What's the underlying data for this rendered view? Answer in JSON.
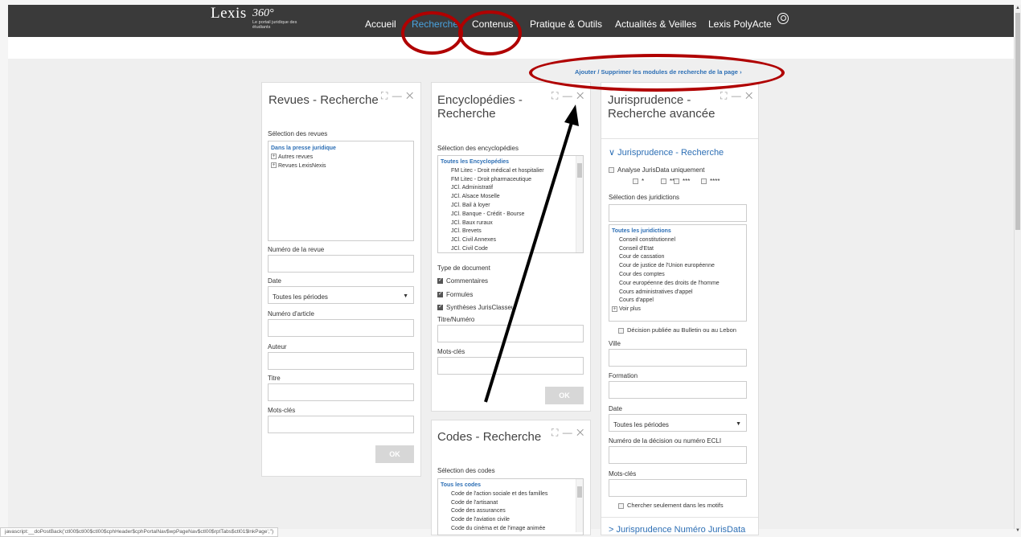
{
  "header": {
    "logo_word": "Lexis",
    "logo_num": "360°",
    "logo_tagline": "Le portail juridique des étudiants",
    "nav": [
      "Accueil",
      "Recherche",
      "Contenus",
      "Pratique & Outils",
      "Actualités & Veilles",
      "Lexis PolyActe"
    ]
  },
  "add_modules_link": "Ajouter / Supprimer les modules de recherche de la page ›",
  "revues": {
    "title": "Revues - Recherche",
    "selection_label": "Sélection des revues",
    "list_head": "Dans la presse juridique",
    "list_items": [
      "Autres revues",
      "Revues LexisNexis"
    ],
    "numero_revue": "Numéro de la revue",
    "date_label": "Date",
    "date_value": "Toutes les périodes",
    "numero_article": "Numéro d'article",
    "auteur": "Auteur",
    "titre": "Titre",
    "mots_cles": "Mots-clés",
    "ok": "OK"
  },
  "encyclopedies": {
    "title_line1": "Encyclopédies -",
    "title_line2": "Recherche",
    "selection_label": "Sélection des encyclopédies",
    "list_head": "Toutes les Encyclopédies",
    "list_items": [
      "FM Litec - Droit médical et hospitalier",
      "FM Litec - Droit pharmaceutique",
      "JCl. Administratif",
      "JCl. Alsace Moselle",
      "JCl. Bail à loyer",
      "JCl. Banque - Crédit - Bourse",
      "JCl. Baux ruraux",
      "JCl. Brevets",
      "JCl. Civil Annexes",
      "JCl. Civil Code"
    ],
    "type_label": "Type de document",
    "types": [
      "Commentaires",
      "Formules",
      "Synthèses JurisClasseur"
    ],
    "titre_numero": "Titre/Numéro",
    "mots_cles": "Mots-clés",
    "ok": "OK"
  },
  "codes": {
    "title": "Codes - Recherche",
    "selection_label": "Sélection des codes",
    "list_head": "Tous les codes",
    "list_items": [
      "Code de l'action sociale et des familles",
      "Code de l'artisanat",
      "Code des assurances",
      "Code de l'aviation civile",
      "Code du cinéma et de l'image animée"
    ]
  },
  "jurisprudence": {
    "title_line1": "Jurisprudence -",
    "title_line2": "Recherche avancée",
    "section_label": "Jurisprudence - Recherche",
    "analyse": "Analyse JurisData uniquement",
    "stars": [
      "*",
      "**",
      "***",
      "****"
    ],
    "selection_label": "Sélection des juridictions",
    "list_head": "Toutes les juridictions",
    "list_items": [
      "Conseil constitutionnel",
      "Conseil d'Etat",
      "Cour de cassation",
      "Cour de justice de l'Union européenne",
      "Cour des comptes",
      "Cour européenne des droits de l'homme",
      "Cours administratives d'appel",
      "Cours d'appel"
    ],
    "voir_plus": "Voir plus",
    "decision_publiee": "Décision publiée au Bulletin ou au Lebon",
    "ville": "Ville",
    "formation": "Formation",
    "date_label": "Date",
    "date_value": "Toutes les périodes",
    "numero_decision": "Numéro de la décision ou numéro ECLI",
    "mots_cles": "Mots-clés",
    "chercher_motifs": "Chercher seulement dans les motifs",
    "numero_jurisdata": "Jurisprudence Numéro JurisData"
  },
  "status_bar": "javascript:__doPostBack('ctl00$ctl00$ctl00$cphHeader$cphPortalNav$wpPageNav$ctl00$rptTabs$ctl01$lnkPage','')",
  "annotation_color": "#b00000"
}
